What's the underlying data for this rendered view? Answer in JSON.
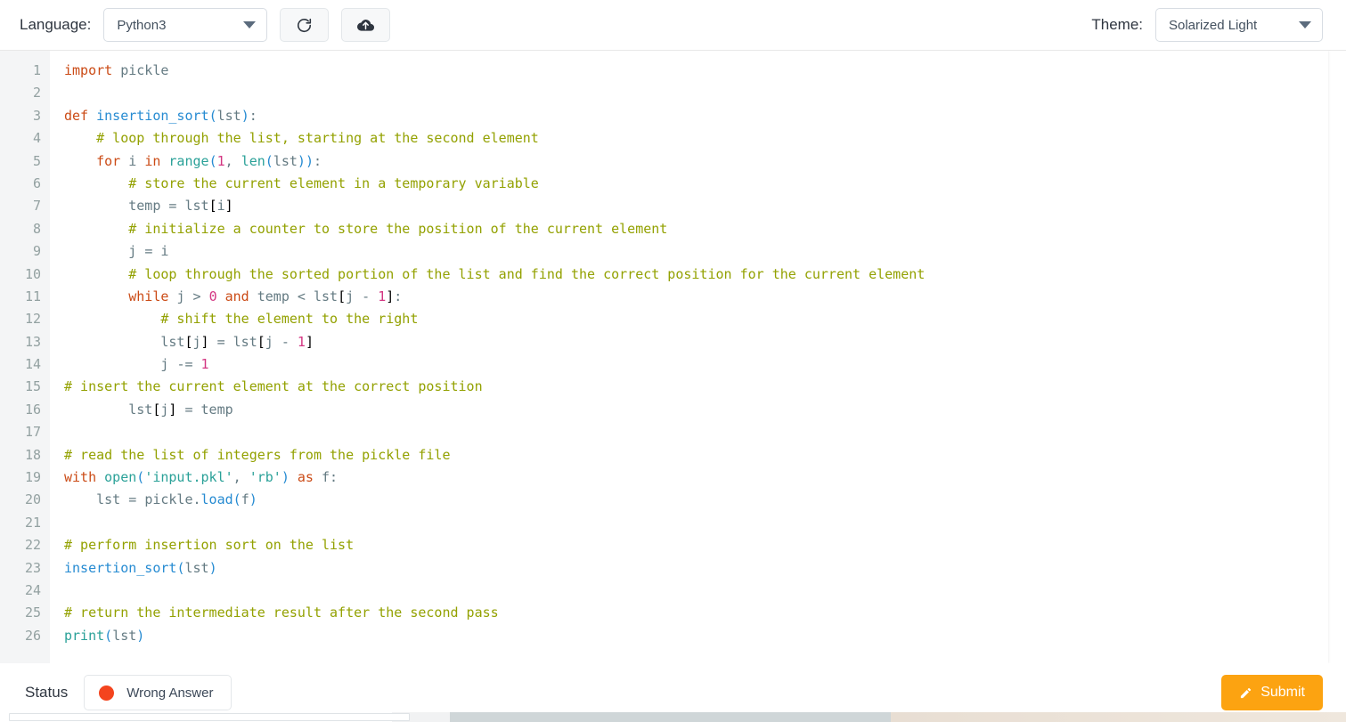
{
  "toolbar": {
    "language_label": "Language:",
    "language_value": "Python3",
    "theme_label": "Theme:",
    "theme_value": "Solarized Light",
    "reset_icon": "refresh-icon",
    "upload_icon": "cloud-upload-icon"
  },
  "editor": {
    "first_line_number": 1,
    "total_lines": 26,
    "line_numbers": [
      1,
      2,
      3,
      4,
      5,
      6,
      7,
      8,
      9,
      10,
      11,
      12,
      13,
      14,
      15,
      16,
      17,
      18,
      19,
      20,
      21,
      22,
      23,
      24,
      25,
      26
    ],
    "lines": [
      "import pickle",
      "",
      "def insertion_sort(lst):",
      "    # loop through the list, starting at the second element",
      "    for i in range(1, len(lst)):",
      "        # store the current element in a temporary variable",
      "        temp = lst[i]",
      "        # initialize a counter to store the position of the current element",
      "        j = i",
      "        # loop through the sorted portion of the list and find the correct position for the current element",
      "        while j > 0 and temp < lst[j - 1]:",
      "            # shift the element to the right",
      "            lst[j] = lst[j - 1]",
      "            j -= 1",
      "# insert the current element at the correct position",
      "        lst[j] = temp",
      "",
      "# read the list of integers from the pickle file",
      "with open('input.pkl', 'rb') as f:",
      "    lst = pickle.load(f)",
      "",
      "# perform insertion sort on the list",
      "insertion_sort(lst)",
      "",
      "# return the intermediate result after the second pass",
      "print(lst)"
    ]
  },
  "status": {
    "label": "Status",
    "verdict": "Wrong Answer",
    "verdict_color": "#f4441e",
    "submit_label": "Submit",
    "submit_icon": "pencil-icon",
    "submit_color": "#fca311"
  }
}
